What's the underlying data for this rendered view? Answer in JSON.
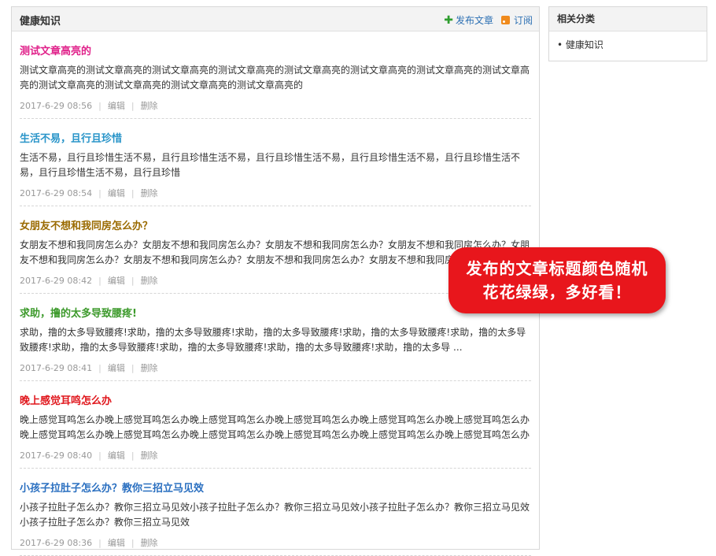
{
  "header": {
    "title": "健康知识",
    "publish_label": "发布文章",
    "subscribe_label": "订阅"
  },
  "articles": [
    {
      "title": "测试文章高亮的",
      "color": "#e0218a",
      "body": "测试文章高亮的测试文章高亮的测试文章高亮的测试文章高亮的测试文章高亮的测试文章高亮的测试文章高亮的测试文章高亮的测试文章高亮的测试文章高亮的测试文章高亮的测试文章高亮的",
      "date": "2017-6-29 08:56",
      "edit": "编辑",
      "delete": "删除"
    },
    {
      "title": "生活不易，且行且珍惜",
      "color": "#2a95c9",
      "body": "生活不易，且行且珍惜生活不易，且行且珍惜生活不易，且行且珍惜生活不易，且行且珍惜生活不易，且行且珍惜生活不易，且行且珍惜生活不易，且行且珍惜",
      "date": "2017-6-29 08:54",
      "edit": "编辑",
      "delete": "删除"
    },
    {
      "title": "女朋友不想和我同房怎么办？",
      "color": "#9a6a00",
      "body": "女朋友不想和我同房怎么办？女朋友不想和我同房怎么办？女朋友不想和我同房怎么办？女朋友不想和我同房怎么办？女朋友不想和我同房怎么办？女朋友不想和我同房怎么办？女朋友不想和我同房怎么办？女朋友不想和我同房怎么 ...",
      "date": "2017-6-29 08:42",
      "edit": "编辑",
      "delete": "删除"
    },
    {
      "title": "求助，撸的太多导致腰疼!",
      "color": "#3d9a2c",
      "body": "求助，撸的太多导致腰疼!求助，撸的太多导致腰疼!求助，撸的太多导致腰疼!求助，撸的太多导致腰疼!求助，撸的太多导致腰疼!求助，撸的太多导致腰疼!求助，撸的太多导致腰疼!求助，撸的太多导致腰疼!求助，撸的太多导 ...",
      "date": "2017-6-29 08:41",
      "edit": "编辑",
      "delete": "删除"
    },
    {
      "title": "晚上感觉耳鸣怎么办",
      "color": "#e0161c",
      "body": "晚上感觉耳鸣怎么办晚上感觉耳鸣怎么办晚上感觉耳鸣怎么办晚上感觉耳鸣怎么办晚上感觉耳鸣怎么办晚上感觉耳鸣怎么办晚上感觉耳鸣怎么办晚上感觉耳鸣怎么办晚上感觉耳鸣怎么办晚上感觉耳鸣怎么办晚上感觉耳鸣怎么办晚上感觉耳鸣怎么办",
      "date": "2017-6-29 08:40",
      "edit": "编辑",
      "delete": "删除"
    },
    {
      "title": "小孩子拉肚子怎么办？教你三招立马见效",
      "color": "#2a6fc0",
      "body": "小孩子拉肚子怎么办？教你三招立马见效小孩子拉肚子怎么办？教你三招立马见效小孩子拉肚子怎么办？教你三招立马见效小孩子拉肚子怎么办？教你三招立马见效",
      "date": "2017-6-29 08:36",
      "edit": "编辑",
      "delete": "删除"
    }
  ],
  "sidebar": {
    "title": "相关分类",
    "items": [
      "• 健康知识"
    ]
  },
  "callout": {
    "line1": "发布的文章标题颜色随机",
    "line2": "花花绿绿，多好看！"
  }
}
